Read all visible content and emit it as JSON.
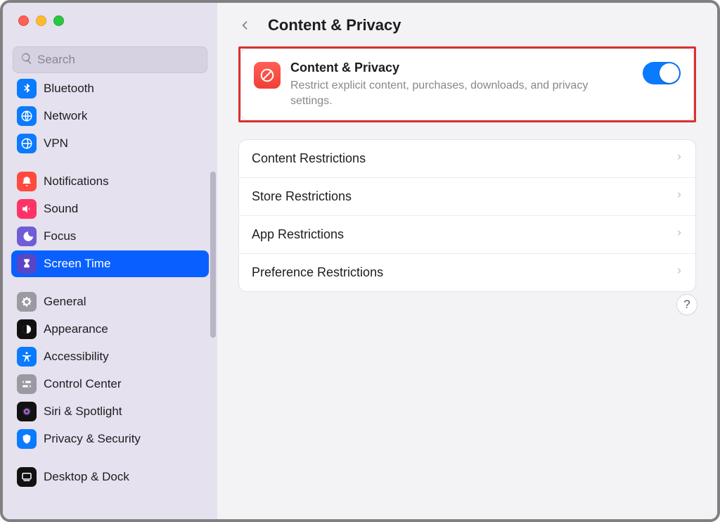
{
  "search": {
    "placeholder": "Search"
  },
  "sidebar": {
    "items": [
      {
        "id": "bluetooth",
        "label": "Bluetooth",
        "color": "#0a7aff"
      },
      {
        "id": "network",
        "label": "Network",
        "color": "#0a7aff"
      },
      {
        "id": "vpn",
        "label": "VPN",
        "color": "#0a7aff"
      },
      {
        "id": "notifications",
        "label": "Notifications",
        "color": "#ff4a3d"
      },
      {
        "id": "sound",
        "label": "Sound",
        "color": "#ff4a66"
      },
      {
        "id": "focus",
        "label": "Focus",
        "color": "#6f5cd6"
      },
      {
        "id": "screentime",
        "label": "Screen Time",
        "color": "#6f5cd6",
        "active": true
      },
      {
        "id": "general",
        "label": "General",
        "color": "#9a9aa0"
      },
      {
        "id": "appearance",
        "label": "Appearance",
        "color": "#111111"
      },
      {
        "id": "accessibility",
        "label": "Accessibility",
        "color": "#0a7aff"
      },
      {
        "id": "controlcenter",
        "label": "Control Center",
        "color": "#9a9aa0"
      },
      {
        "id": "siri",
        "label": "Siri & Spotlight",
        "color": "#111111"
      },
      {
        "id": "privacy",
        "label": "Privacy & Security",
        "color": "#0a7aff"
      },
      {
        "id": "desktopdock",
        "label": "Desktop & Dock",
        "color": "#111111"
      }
    ]
  },
  "header": {
    "title": "Content & Privacy"
  },
  "hero": {
    "title": "Content & Privacy",
    "description": "Restrict explicit content, purchases, downloads, and privacy settings.",
    "toggle_on": true
  },
  "restrictions": [
    {
      "label": "Content Restrictions"
    },
    {
      "label": "Store Restrictions"
    },
    {
      "label": "App Restrictions"
    },
    {
      "label": "Preference Restrictions"
    }
  ],
  "help": {
    "label": "?"
  }
}
